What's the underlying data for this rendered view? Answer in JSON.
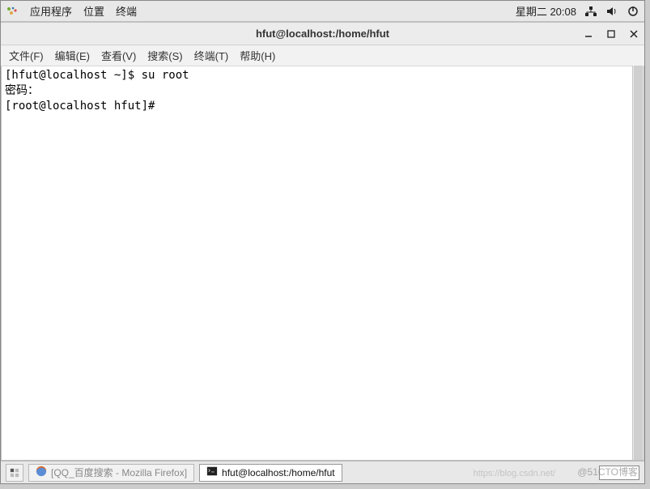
{
  "top_panel": {
    "menus": {
      "apps": "应用程序",
      "places": "位置",
      "terminal": "终端"
    },
    "date": "星期二 20:08"
  },
  "window": {
    "title": "hfut@localhost:/home/hfut",
    "menubar": {
      "file": "文件(F)",
      "edit": "编辑(E)",
      "view": "查看(V)",
      "search": "搜索(S)",
      "terminal": "终端(T)",
      "help": "帮助(H)"
    },
    "terminal_lines": [
      "[hfut@localhost ~]$ su root",
      "密码：",
      "[root@localhost hfut]#"
    ]
  },
  "taskbar": {
    "firefox": "[QQ_百度搜索 - Mozilla Firefox]",
    "terminal": "hfut@localhost:/home/hfut"
  },
  "watermark": "@51CTO博客",
  "watermark2": "https://blog.csdn.net/"
}
